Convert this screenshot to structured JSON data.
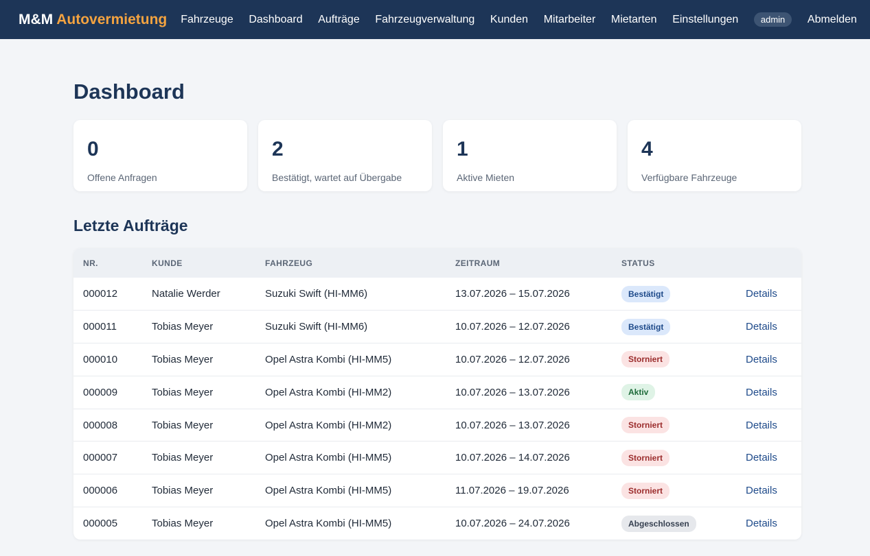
{
  "brand": {
    "part1": "M&M",
    "part2": "Autovermietung"
  },
  "nav": {
    "items": [
      "Fahrzeuge",
      "Dashboard",
      "Aufträge",
      "Fahrzeugverwaltung",
      "Kunden",
      "Mitarbeiter",
      "Mietarten",
      "Einstellungen"
    ],
    "user": "admin",
    "logout": "Abmelden"
  },
  "page": {
    "title": "Dashboard"
  },
  "stats": [
    {
      "value": "0",
      "label": "Offene Anfragen"
    },
    {
      "value": "2",
      "label": "Bestätigt, wartet auf Übergabe"
    },
    {
      "value": "1",
      "label": "Aktive Mieten"
    },
    {
      "value": "4",
      "label": "Verfügbare Fahrzeuge"
    }
  ],
  "orders": {
    "title": "Letzte Aufträge",
    "columns": [
      "NR.",
      "KUNDE",
      "FAHRZEUG",
      "ZEITRAUM",
      "STATUS"
    ],
    "details_label": "Details",
    "rows": [
      {
        "nr": "000012",
        "kunde": "Natalie Werder",
        "fahrzeug": "Suzuki Swift (HI-MM6)",
        "zeitraum": "13.07.2026 – 15.07.2026",
        "status": "Bestätigt",
        "status_type": "best"
      },
      {
        "nr": "000011",
        "kunde": "Tobias Meyer",
        "fahrzeug": "Suzuki Swift (HI-MM6)",
        "zeitraum": "10.07.2026 – 12.07.2026",
        "status": "Bestätigt",
        "status_type": "best"
      },
      {
        "nr": "000010",
        "kunde": "Tobias Meyer",
        "fahrzeug": "Opel Astra Kombi (HI-MM5)",
        "zeitraum": "10.07.2026 – 12.07.2026",
        "status": "Storniert",
        "status_type": "storn"
      },
      {
        "nr": "000009",
        "kunde": "Tobias Meyer",
        "fahrzeug": "Opel Astra Kombi (HI-MM2)",
        "zeitraum": "10.07.2026 – 13.07.2026",
        "status": "Aktiv",
        "status_type": "aktiv"
      },
      {
        "nr": "000008",
        "kunde": "Tobias Meyer",
        "fahrzeug": "Opel Astra Kombi (HI-MM2)",
        "zeitraum": "10.07.2026 – 13.07.2026",
        "status": "Storniert",
        "status_type": "storn"
      },
      {
        "nr": "000007",
        "kunde": "Tobias Meyer",
        "fahrzeug": "Opel Astra Kombi (HI-MM5)",
        "zeitraum": "10.07.2026 – 14.07.2026",
        "status": "Storniert",
        "status_type": "storn"
      },
      {
        "nr": "000006",
        "kunde": "Tobias Meyer",
        "fahrzeug": "Opel Astra Kombi (HI-MM5)",
        "zeitraum": "11.07.2026 – 19.07.2026",
        "status": "Storniert",
        "status_type": "storn"
      },
      {
        "nr": "000005",
        "kunde": "Tobias Meyer",
        "fahrzeug": "Opel Astra Kombi (HI-MM5)",
        "zeitraum": "10.07.2026 – 24.07.2026",
        "status": "Abgeschlossen",
        "status_type": "abg"
      }
    ]
  }
}
